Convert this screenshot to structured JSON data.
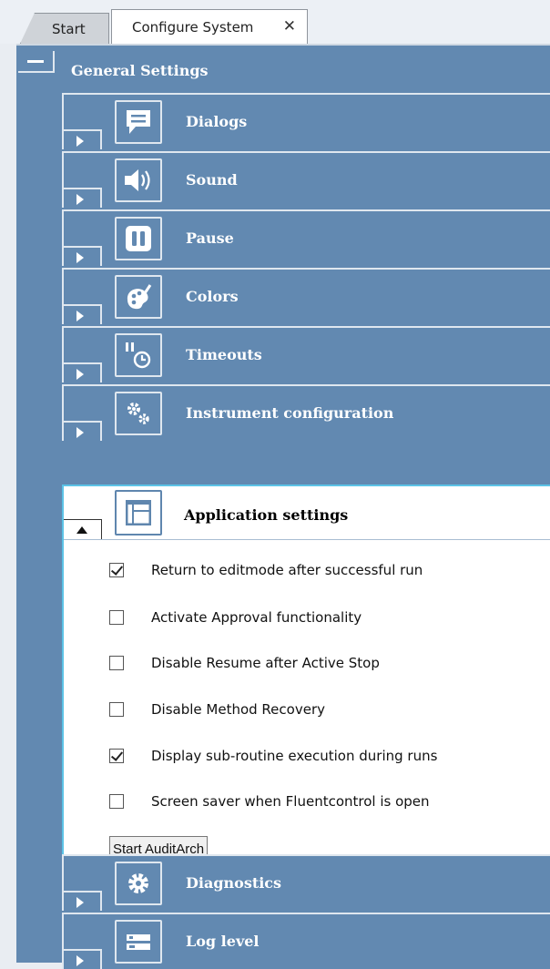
{
  "tabs": {
    "start_label": "Start",
    "configure_label": "Configure System",
    "close_glyph": "✕"
  },
  "general_settings": {
    "title": "General Settings",
    "collapsed_rows": [
      {
        "label": "Dialogs",
        "icon": "speech-bubble-icon"
      },
      {
        "label": "Sound",
        "icon": "speaker-icon"
      },
      {
        "label": "Pause",
        "icon": "pause-icon"
      },
      {
        "label": "Colors",
        "icon": "palette-icon"
      },
      {
        "label": "Timeouts",
        "icon": "timer-icon"
      },
      {
        "label": "Instrument configuration",
        "icon": "gears-icon"
      }
    ],
    "expanded": {
      "label": "Application settings",
      "icon": "layout-icon",
      "options": [
        {
          "label": "Return to editmode after successful run",
          "checked": true
        },
        {
          "label": "Activate Approval functionality",
          "checked": false
        },
        {
          "label": "Disable Resume after Active Stop",
          "checked": false
        },
        {
          "label": "Disable Method Recovery",
          "checked": false
        },
        {
          "label": "Display sub-routine execution during runs",
          "checked": true
        },
        {
          "label": "Screen saver when Fluentcontrol is open",
          "checked": false
        }
      ],
      "button_label": "Start AuditArch"
    },
    "after_rows": [
      {
        "label": "Diagnostics",
        "icon": "gear-icon"
      },
      {
        "label": "Log level",
        "icon": "log-level-icon"
      }
    ]
  },
  "colors": {
    "panel": "#6289b1",
    "row_border": "#dfe7ef",
    "expanded_border": "#5cc3e6"
  }
}
